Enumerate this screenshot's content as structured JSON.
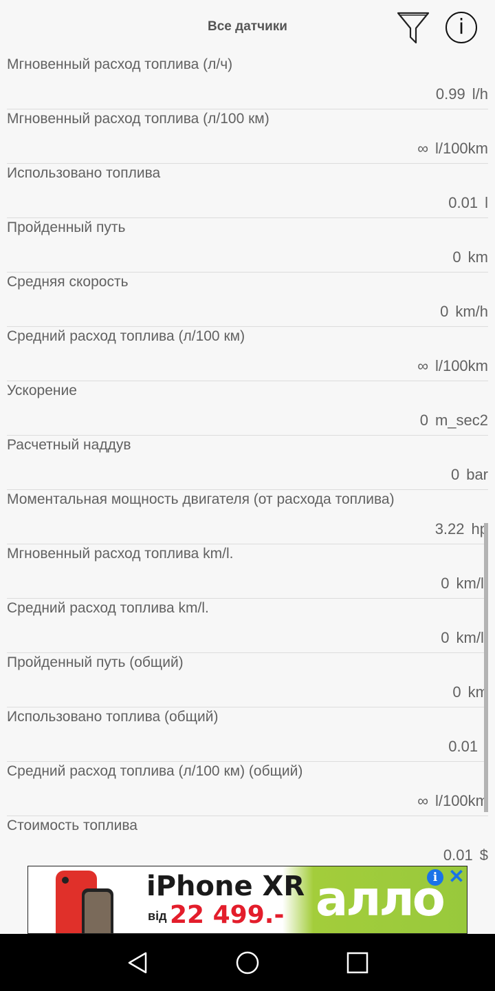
{
  "header": {
    "title": "Все датчики",
    "filter_icon": "filter-icon",
    "info_icon": "info-icon",
    "info_glyph": "i"
  },
  "sensors": [
    {
      "label": "Мгновенный расход топлива (л/ч)",
      "value": "",
      "unit": ""
    },
    {
      "label": "",
      "value": "0.99",
      "unit": "l/h"
    },
    {
      "label": "Мгновенный расход топлива (л/100 км)",
      "value": "∞",
      "unit": "l/100km"
    },
    {
      "label": "Использовано топлива",
      "value": "0.01",
      "unit": "l"
    },
    {
      "label": "Пройденный путь",
      "value": "0",
      "unit": "km"
    },
    {
      "label": "Средняя скорость",
      "value": "0",
      "unit": "km/h"
    },
    {
      "label": "Средний расход топлива (л/100 км)",
      "value": "∞",
      "unit": "l/100km"
    },
    {
      "label": "Ускорение",
      "value": "0",
      "unit": "m_sec2"
    },
    {
      "label": "Расчетный наддув",
      "value": "0",
      "unit": "bar"
    },
    {
      "label": "Моментальная мощность двигателя (от расхода топлива)",
      "value": "3.22",
      "unit": "hp"
    },
    {
      "label": "Мгновенный расход топлива km/l.",
      "value": "0",
      "unit": "km/l."
    },
    {
      "label": "Средний расход топлива km/l.",
      "value": "0",
      "unit": "km/l."
    },
    {
      "label": "Пройденный путь (общий)",
      "value": "0",
      "unit": "km"
    },
    {
      "label": "Использовано топлива (общий)",
      "value": "0.01",
      "unit": "l"
    },
    {
      "label": "Средний расход топлива (л/100 км) (общий)",
      "value": "∞",
      "unit": "l/100km"
    },
    {
      "label": "Стоимость топлива",
      "value": "0.01",
      "unit": "$"
    }
  ],
  "ad": {
    "title": "iPhone XR",
    "from_label": "від",
    "price": "22 499.-",
    "brand": "алло",
    "info_glyph": "i",
    "close_glyph": "✕"
  },
  "navbar": {
    "back_icon": "back-triangle-icon",
    "home_icon": "home-circle-icon",
    "recents_icon": "recents-square-icon"
  },
  "colors": {
    "background": "#f7f7f7",
    "text": "#616161",
    "price_red": "#e31d2b",
    "brand_green": "#98c93c",
    "ad_blue": "#1a73e8"
  }
}
